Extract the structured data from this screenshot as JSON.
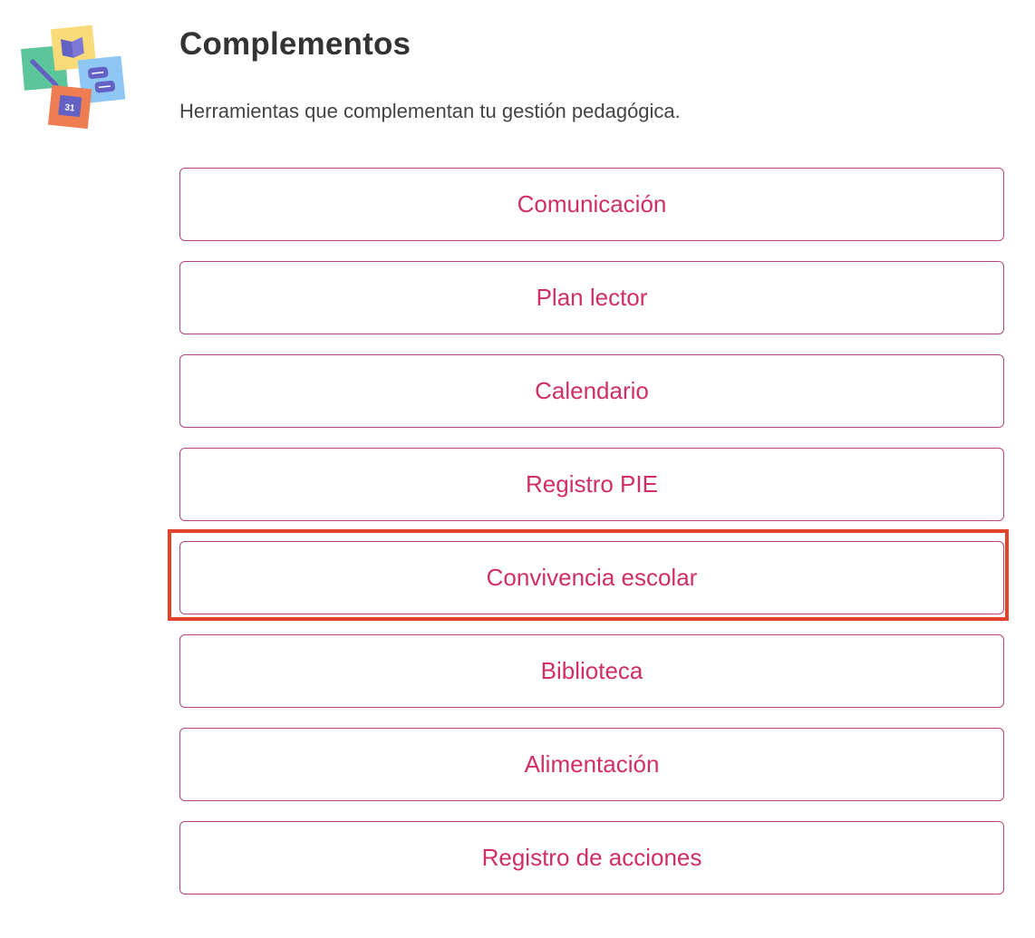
{
  "header": {
    "title": "Complementos",
    "subtitle": "Herramientas que complementan tu gestión pedagógica."
  },
  "logo": {
    "calendar_number": "31",
    "colors": {
      "green": "#5cc59a",
      "yellow": "#f9dc79",
      "blue": "#8ec6f4",
      "orange": "#ee7e52",
      "purple": "#6461c4"
    }
  },
  "items": [
    {
      "label": "Comunicación"
    },
    {
      "label": "Plan lector"
    },
    {
      "label": "Calendario"
    },
    {
      "label": "Registro PIE"
    },
    {
      "label": "Convivencia escolar",
      "highlighted": true
    },
    {
      "label": "Biblioteca"
    },
    {
      "label": "Alimentación"
    },
    {
      "label": "Registro de acciones"
    }
  ],
  "colors": {
    "accent_text": "#d02f64",
    "button_border": "#b3467a",
    "highlight_border": "#e3432c"
  }
}
